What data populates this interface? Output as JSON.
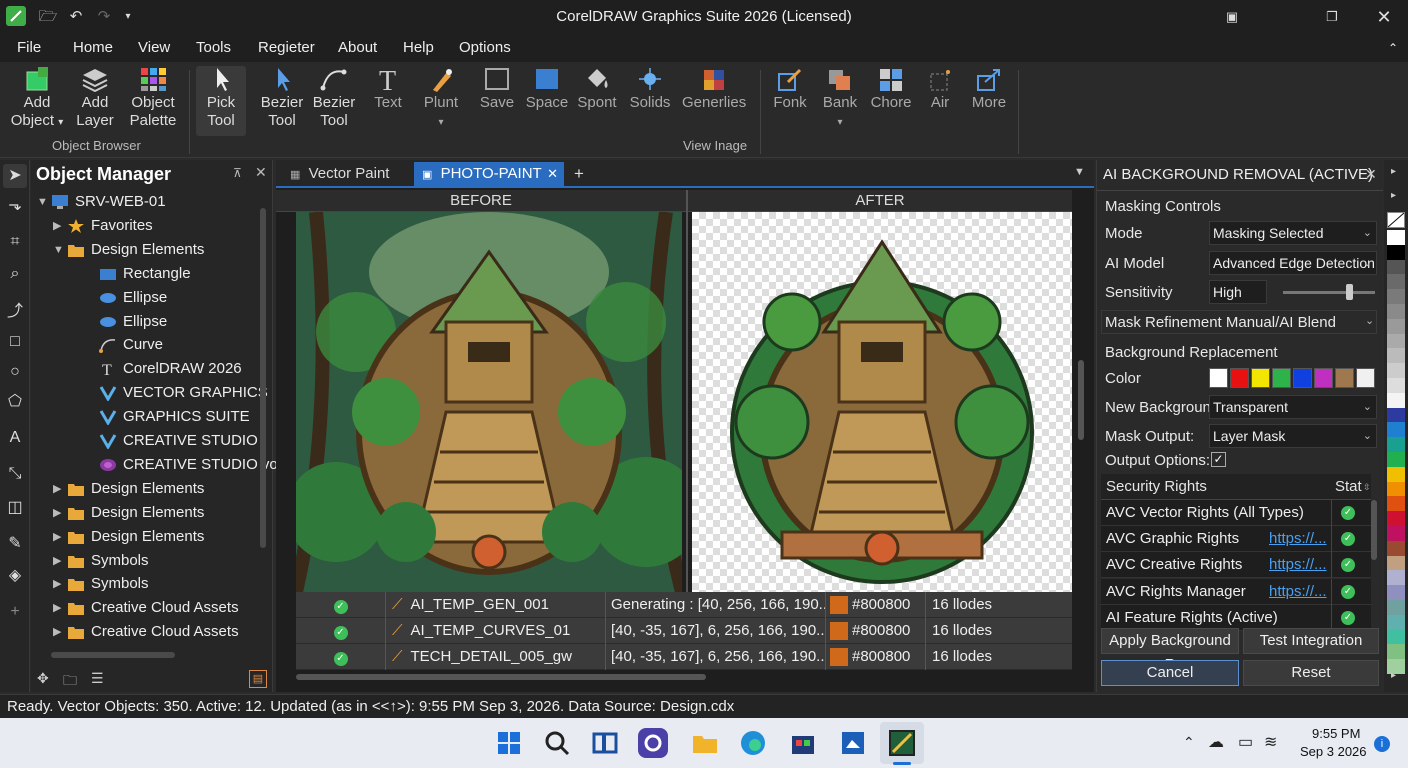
{
  "window": {
    "title": "CorelDRAW Graphics Suite 2026 (Licensed)"
  },
  "menu": [
    "File",
    "Home",
    "View",
    "Tools",
    "Regieter",
    "About",
    "Help",
    "Options"
  ],
  "ribbon": {
    "buttons": [
      {
        "label1": "Add",
        "label2": "Object",
        "caret": "▾"
      },
      {
        "label1": "Add",
        "label2": "Layer"
      },
      {
        "label1": "Object",
        "label2": "Palette"
      },
      {
        "label1": "Pick",
        "label2": "Tool"
      },
      {
        "label1": "Bezier",
        "label2": "Tool"
      },
      {
        "label1": "Bezier",
        "label2": "Tool"
      },
      {
        "label1": "Text",
        "label2": ""
      },
      {
        "label1": "Plunt",
        "label2": "▾"
      },
      {
        "label1": "Save",
        "label2": ""
      },
      {
        "label1": "Space",
        "label2": ""
      },
      {
        "label1": "Spont",
        "label2": ""
      },
      {
        "label1": "Solids",
        "label2": ""
      },
      {
        "label1": "Generlies",
        "label2": ""
      },
      {
        "label1": "Fonk",
        "label2": ""
      },
      {
        "label1": "Bank",
        "label2": "▾"
      },
      {
        "label1": "Chore",
        "label2": ""
      },
      {
        "label1": "Air",
        "label2": ""
      },
      {
        "label1": "More",
        "label2": ""
      }
    ],
    "group_object_browser": "Object Browser",
    "group_view_image": "View Inage"
  },
  "object_manager": {
    "title": "Object Manager",
    "rows": [
      {
        "label": "SRV-WEB-01",
        "level": 0,
        "icon": "monitor",
        "arrow": "▼"
      },
      {
        "label": "Favorites",
        "level": 1,
        "icon": "star",
        "arrow": "▶"
      },
      {
        "label": "Design Elements",
        "level": 1,
        "icon": "folder",
        "arrow": "▼"
      },
      {
        "label": "Rectangle",
        "level": 2,
        "icon": "rect",
        "arrow": ""
      },
      {
        "label": "Ellipse",
        "level": 2,
        "icon": "ellipse",
        "arrow": ""
      },
      {
        "label": "Ellipse",
        "level": 2,
        "icon": "ellipse",
        "arrow": ""
      },
      {
        "label": "Curve",
        "level": 2,
        "icon": "curve",
        "arrow": ""
      },
      {
        "label": "CorelDRAW 2026",
        "level": 2,
        "icon": "text",
        "arrow": ""
      },
      {
        "label": "VECTOR GRAPHICS",
        "level": 2,
        "icon": "v",
        "arrow": ""
      },
      {
        "label": "GRAPHICS SUITE",
        "level": 2,
        "icon": "v",
        "arrow": ""
      },
      {
        "label": "CREATIVE STUDIO",
        "level": 2,
        "icon": "v",
        "arrow": ""
      },
      {
        "label": "CREATIVE STUDIO vol.",
        "level": 2,
        "icon": "swirl",
        "arrow": ""
      },
      {
        "label": "Design Elements",
        "level": 1,
        "icon": "folder",
        "arrow": "▶"
      },
      {
        "label": "Design Elements",
        "level": 1,
        "icon": "folder",
        "arrow": "▶"
      },
      {
        "label": "Design Elements",
        "level": 1,
        "icon": "folder",
        "arrow": "▶"
      },
      {
        "label": "Symbols",
        "level": 1,
        "icon": "folder",
        "arrow": "▶"
      },
      {
        "label": "Symbols",
        "level": 1,
        "icon": "folder",
        "arrow": "▶"
      },
      {
        "label": "Creative Cloud Assets",
        "level": 1,
        "icon": "folder",
        "arrow": "▶"
      },
      {
        "label": "Creative Cloud Assets",
        "level": 1,
        "icon": "folder",
        "arrow": "▶"
      }
    ]
  },
  "tabs": [
    {
      "label": "Vector Paint"
    },
    {
      "label": "PHOTO-PAINT"
    }
  ],
  "tab_add": "+",
  "canvas": {
    "before": "BEFORE",
    "after": "AFTER"
  },
  "grid": [
    {
      "name": "AI_TEMP_GEN_001",
      "data": "Generating : [40, 256, 166, 190...",
      "color": "#800800",
      "nodes": "16 llodes"
    },
    {
      "name": "AI_TEMP_CURVES_01",
      "data": "[40, -35, 167], 6, 256, 166, 190...",
      "color": "#800800",
      "nodes": "16 llodes"
    },
    {
      "name": "TECH_DETAIL_005_gw",
      "data": "[40, -35, 167], 6, 256, 166, 190...",
      "color": "#800800",
      "nodes": "16 llodes"
    }
  ],
  "ai": {
    "title": "AI BACKGROUND REMOVAL (ACTIVE)",
    "masking_controls": "Masking Controls",
    "mode_label": "Mode",
    "mode_value": "Masking Selected",
    "model_label": "AI Model",
    "model_value": "Advanced Edge Detection",
    "sens_label": "Sensitivity",
    "sens_value": "High",
    "sens_level": 0.75,
    "refine_label": "Mask Refinement Manual/AI Blend",
    "bg_replace": "Background Replacement",
    "color_label": "Color",
    "swatches": [
      "#ffffff",
      "#e81010",
      "#f2e600",
      "#2db34a",
      "#1040e0",
      "#c030c0",
      "#a07850",
      "#f0f0f0"
    ],
    "newbg_label": "New Background:",
    "newbg_value": "Transparent",
    "maskout_label": "Mask Output:",
    "maskout_value": "Layer Mask",
    "outopt_label": "Output Options:",
    "outopt_check": "✓",
    "sec_header": "Security Rights",
    "sec_stat": "Stat",
    "sec_rows": [
      {
        "name": "AVC Vector Rights (All Types)",
        "link": ""
      },
      {
        "name": "AVC Graphic Rights",
        "link": "https://..."
      },
      {
        "name": "AVC Creative Rights",
        "link": "https://..."
      },
      {
        "name": "AVC Rights Manager",
        "link": "https://..."
      },
      {
        "name": "AI Feature Rights (Active)",
        "link": ""
      }
    ],
    "apply_btn": "Apply Background R",
    "test_btn": "Test Integration",
    "cancel_btn": "Cancel",
    "reset_btn": "Reset"
  },
  "palette": [
    "#ffffff",
    "#000000",
    "#555555",
    "#6a6a6a",
    "#7a7a7a",
    "#8a8a8a",
    "#9a9a9a",
    "#aaaaaa",
    "#bbbbbb",
    "#cccccc",
    "#dddddd",
    "#f4f4f4",
    "#2d3aa0",
    "#1f7fd0",
    "#18a090",
    "#20b050",
    "#f0c000",
    "#f09000",
    "#e05010",
    "#d01030",
    "#c01060",
    "#9a4a30",
    "#c0a080",
    "#b0b0d0",
    "#9090c0",
    "#70a0a0",
    "#60b0b0",
    "#40c0a0",
    "#80c080",
    "#a0d0a0"
  ],
  "status": "Ready. Vector Objects: 350. Active: 12. Updated (as in <<↑>): 9:55 PM Sep 3, 2026. Data Source: Design.cdx",
  "clock": {
    "time": "9:55 PM",
    "date": "Sep 3 2026"
  }
}
